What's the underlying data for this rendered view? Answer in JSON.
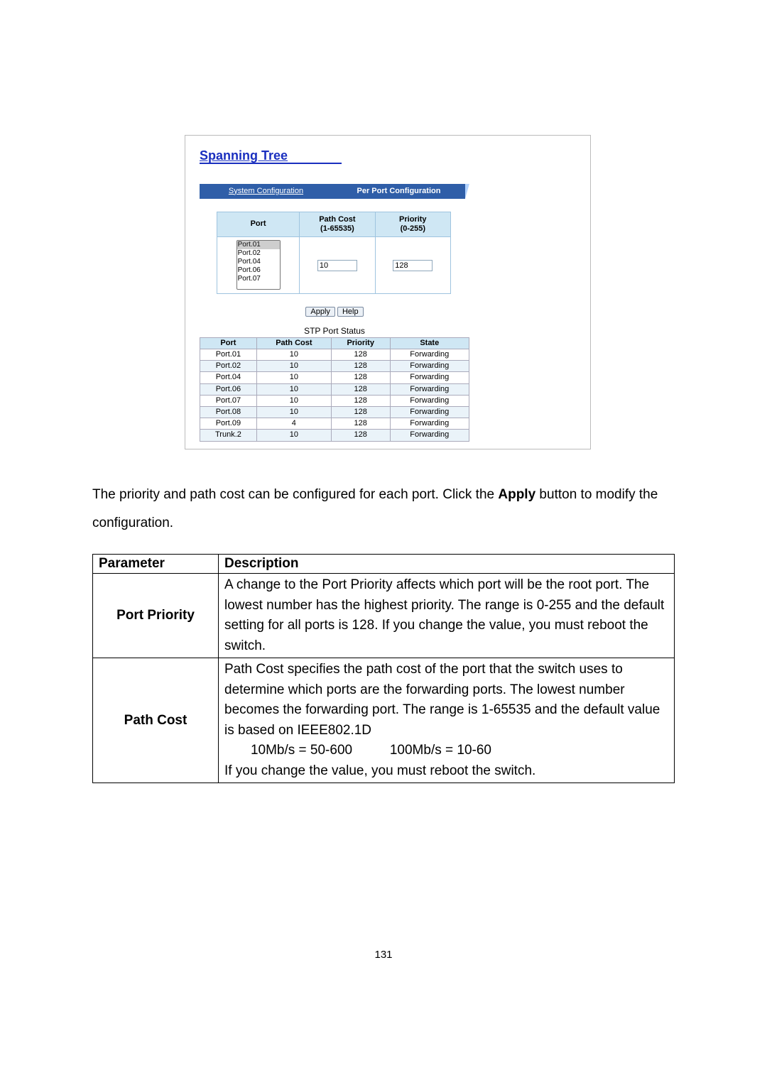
{
  "panel": {
    "title": "Spanning Tree",
    "tabs": {
      "sys": "System Configuration",
      "port": "Per Port Configuration"
    },
    "cfg": {
      "port_h": "Port",
      "path_h_l1": "Path Cost",
      "path_h_l2": "(1-65535)",
      "prio_h_l1": "Priority",
      "prio_h_l2": "(0-255)",
      "ports": [
        "Port.01",
        "Port.02",
        "Port.04",
        "Port.06",
        "Port.07"
      ],
      "path_value": "10",
      "prio_value": "128"
    },
    "buttons": {
      "apply": "Apply",
      "help": "Help"
    },
    "status_title": "STP Port Status",
    "status_head": {
      "port": "Port",
      "path": "Path Cost",
      "prio": "Priority",
      "state": "State"
    },
    "status_rows": [
      {
        "port": "Port.01",
        "path": "10",
        "prio": "128",
        "state": "Forwarding"
      },
      {
        "port": "Port.02",
        "path": "10",
        "prio": "128",
        "state": "Forwarding"
      },
      {
        "port": "Port.04",
        "path": "10",
        "prio": "128",
        "state": "Forwarding"
      },
      {
        "port": "Port.06",
        "path": "10",
        "prio": "128",
        "state": "Forwarding"
      },
      {
        "port": "Port.07",
        "path": "10",
        "prio": "128",
        "state": "Forwarding"
      },
      {
        "port": "Port.08",
        "path": "10",
        "prio": "128",
        "state": "Forwarding"
      },
      {
        "port": "Port.09",
        "path": "4",
        "prio": "128",
        "state": "Forwarding"
      },
      {
        "port": "Trunk.2",
        "path": "10",
        "prio": "128",
        "state": "Forwarding"
      }
    ]
  },
  "text": {
    "p1a": "The priority and path cost can be configured for each port.    Click the ",
    "p1b": "Apply",
    "p1c": " button to modify the configuration."
  },
  "ptable": {
    "h1": "Parameter",
    "h2": "Description",
    "r1_param": "Port Priority",
    "r1_desc": "A change to the Port Priority affects which port will be the root port. The lowest number has the highest priority. The range is 0-255 and the default setting for all ports is 128.   If you change the value, you must reboot the switch.",
    "r2_param": "Path Cost",
    "r2_d1": "Path Cost specifies the path cost of the port that the switch uses to determine which ports are the forwarding ports.   The lowest number becomes the forwarding port.   The range is 1-65535 and the default value is based on IEEE802.1D",
    "r2_d2": "       10Mb/s = 50-600          100Mb/s = 10-60",
    "r2_d3": "If you change the value, you must reboot the switch."
  },
  "page_number": "131"
}
